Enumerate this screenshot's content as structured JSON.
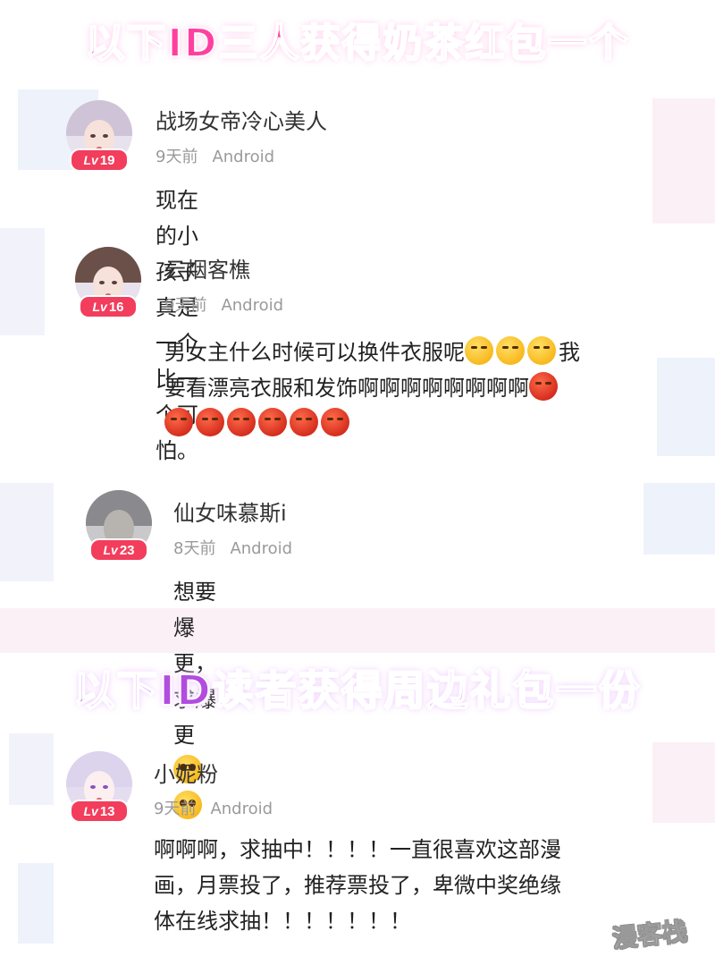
{
  "banners": {
    "top": "以下ID三人获得奶茶红包一个",
    "middle": "以下ID读者获得周边礼包一份"
  },
  "comments": [
    {
      "username": "战场女帝冷心美人",
      "level_prefix": "Lv",
      "level": "19",
      "time": "9天前",
      "device": "Android",
      "text": "现在的小孩子真是一个比一个可怕。"
    },
    {
      "username": "云烟客樵",
      "level_prefix": "Lv",
      "level": "16",
      "time": "9天前",
      "device": "Android",
      "text_line1": "男女主什么时候可以换件衣服呢",
      "text_line1_end": "我",
      "text_line2": "要看漂亮衣服和发饰啊啊啊啊啊啊啊啊"
    },
    {
      "username": "仙女味慕斯i",
      "level_prefix": "Lv",
      "level": "23",
      "time": "8天前",
      "device": "Android",
      "text": "想要爆更，求爆更"
    },
    {
      "username": "小妮粉",
      "level_prefix": "Lv",
      "level": "13",
      "time": "9天前",
      "device": "Android",
      "text_line1": "啊啊啊，求抽中！！！！一直很喜欢这部漫",
      "text_line2": "画，月票投了，推荐票投了，卑微中奖绝缘",
      "text_line3": "体在线求抽！！！！！！！"
    }
  ],
  "watermark": "漫客栈",
  "icons": {
    "sweat_emoji": "sweat-emoji-icon",
    "angry_emoji": "angry-emoji-icon",
    "pity_emoji": "pity-emoji-icon"
  },
  "colors": {
    "top_banner": "#ff3fa0",
    "middle_banner": "#b24ce0",
    "level_badge": "#f23d5c",
    "meta_text": "#9a9a9a"
  }
}
